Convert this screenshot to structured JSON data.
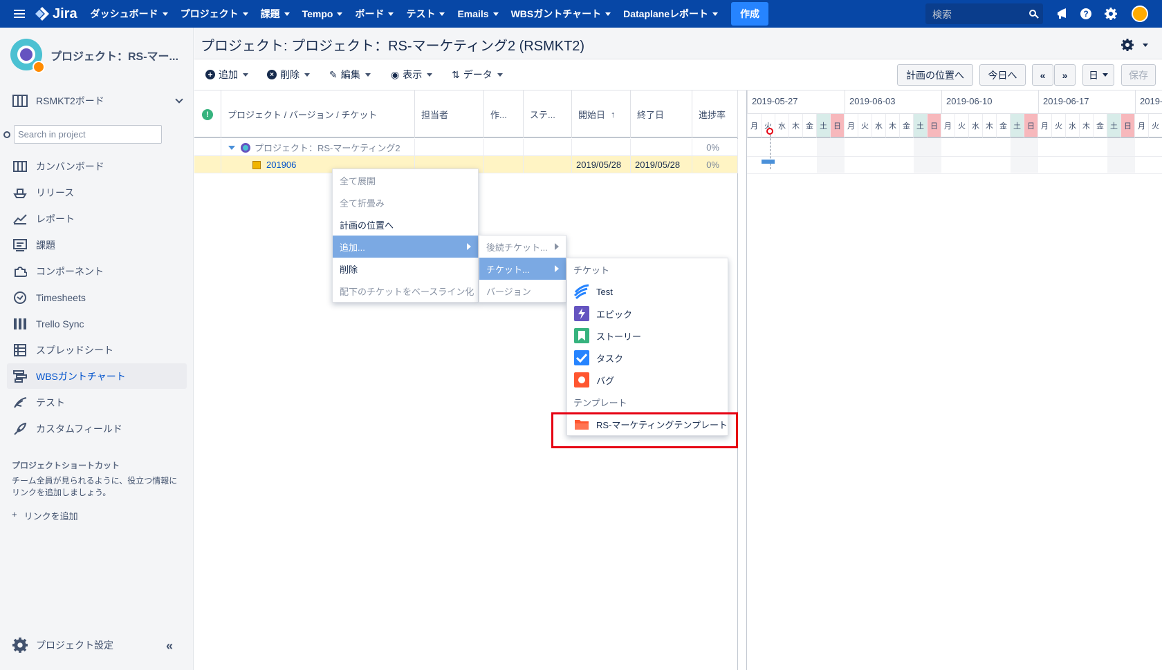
{
  "topnav": {
    "logo_text": "Jira",
    "items": [
      "ダッシュボード",
      "プロジェクト",
      "課題",
      "Tempo",
      "ボード",
      "テスト",
      "Emails",
      "WBSガントチャート",
      "Dataplaneレポート"
    ],
    "create_label": "作成",
    "search_placeholder": "検索",
    "icons": [
      "megaphone-icon",
      "help-icon",
      "gear-icon",
      "user-avatar"
    ]
  },
  "sidebar": {
    "project_name": "プロジェクト：RS-マー...",
    "board_selector": "RSMKT2ボード",
    "search_placeholder": "Search in project",
    "items": [
      {
        "label": "カンバンボード",
        "icon": "kanban-icon"
      },
      {
        "label": "リリース",
        "icon": "ship-icon"
      },
      {
        "label": "レポート",
        "icon": "chart-icon"
      },
      {
        "label": "課題",
        "icon": "issues-icon"
      },
      {
        "label": "コンポーネント",
        "icon": "puzzle-icon"
      },
      {
        "label": "Timesheets",
        "icon": "clock-icon"
      },
      {
        "label": "Trello Sync",
        "icon": "trello-icon"
      },
      {
        "label": "スプレッドシート",
        "icon": "table-icon"
      },
      {
        "label": "WBSガントチャート",
        "icon": "wbs-icon"
      },
      {
        "label": "テスト",
        "icon": "test-icon"
      },
      {
        "label": "カスタムフィールド",
        "icon": "feather-icon"
      }
    ],
    "shortcuts_heading": "プロジェクトショートカット",
    "shortcuts_text": "チーム全員が見られるように、役立つ情報にリンクを追加しましょう。",
    "add_link_label": "リンクを追加",
    "settings_label": "プロジェクト設定"
  },
  "page": {
    "title": "プロジェクト: プロジェクト：RS-マーケティング2 (RSMKT2)"
  },
  "toolbar": {
    "add": "追加",
    "delete": "削除",
    "edit": "編集",
    "view": "表示",
    "data": "データ",
    "goto_plan": "計画の位置へ",
    "today": "今日へ",
    "prev": "«",
    "next": "»",
    "scale": "日",
    "save": "保存"
  },
  "grid": {
    "columns": [
      "プロジェクト / バージョン / チケット",
      "担当者",
      "作...",
      "ステ...",
      "開始日",
      "終了日",
      "進捗率"
    ],
    "rows": [
      {
        "name": "プロジェクト：RS-マーケティング2",
        "start": "",
        "end": "",
        "progress": "0%"
      },
      {
        "name": "201906",
        "start": "2019/05/28",
        "end": "2019/05/28",
        "progress": "0%"
      }
    ]
  },
  "gantt": {
    "weeks": [
      "2019-05-27",
      "2019-06-03",
      "2019-06-10",
      "2019-06-17",
      "2019-"
    ],
    "weekdays": [
      "月",
      "火",
      "水",
      "木",
      "金",
      "土",
      "日"
    ]
  },
  "context_menu": {
    "items": [
      "全て展開",
      "全て折畳み",
      "計画の位置へ",
      "追加...",
      "削除",
      "配下のチケットをベースライン化"
    ],
    "submenu1": [
      "後続チケット...",
      "チケット...",
      "バージョン"
    ],
    "submenu2_heading": "チケット",
    "ticket_types": [
      {
        "label": "Test",
        "icon": "test-type-icon",
        "color": "#2684ff"
      },
      {
        "label": "エピック",
        "icon": "epic-icon",
        "color": "#6554c0"
      },
      {
        "label": "ストーリー",
        "icon": "story-icon",
        "color": "#36b37e"
      },
      {
        "label": "タスク",
        "icon": "task-icon",
        "color": "#2684ff"
      },
      {
        "label": "バグ",
        "icon": "bug-icon",
        "color": "#ff5630"
      }
    ],
    "template_heading": "テンプレート",
    "template_item": "RS-マーケティングテンプレート"
  }
}
